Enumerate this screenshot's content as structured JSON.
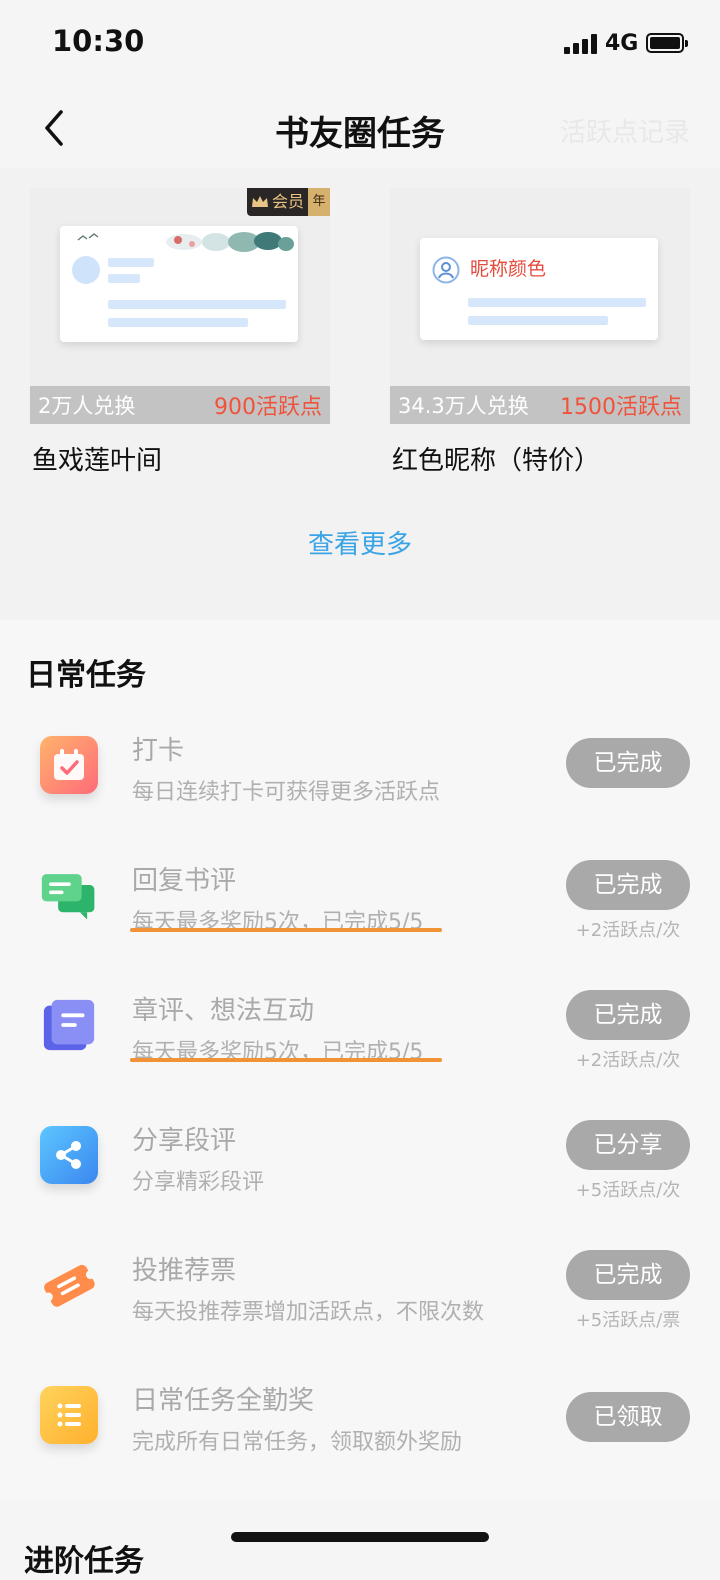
{
  "status_bar": {
    "time": "10:30",
    "network": "4G"
  },
  "nav": {
    "title": "书友圈任务",
    "right_link": "活跃点记录"
  },
  "rewards": [
    {
      "badge": "会员",
      "badge_tag": "年",
      "count": "2万人兑换",
      "points": "900活跃点",
      "name": "鱼戏莲叶间"
    },
    {
      "preview_text": "昵称颜色",
      "count": "34.3万人兑换",
      "points": "1500活跃点",
      "name": "红色昵称（特价）"
    }
  ],
  "see_more": "查看更多",
  "daily": {
    "section_title": "日常任务",
    "tasks": [
      {
        "icon": "calendar-check-icon",
        "title": "打卡",
        "sub": "每日连续打卡可获得更多活跃点",
        "button": "已完成",
        "reward": ""
      },
      {
        "icon": "chat-bubbles-icon",
        "title": "回复书评",
        "sub": "每天最多奖励5次，已完成5/5",
        "button": "已完成",
        "reward": "+2活跃点/次"
      },
      {
        "icon": "document-icon",
        "title": "章评、想法互动",
        "sub": "每天最多奖励5次，已完成5/5",
        "button": "已完成",
        "reward": "+2活跃点/次"
      },
      {
        "icon": "share-icon",
        "title": "分享段评",
        "sub": "分享精彩段评",
        "button": "已分享",
        "reward": "+5活跃点/次"
      },
      {
        "icon": "ticket-icon",
        "title": "投推荐票",
        "sub": "每天投推荐票增加活跃点，不限次数",
        "button": "已完成",
        "reward": "+5活跃点/票"
      },
      {
        "icon": "list-icon",
        "title": "日常任务全勤奖",
        "sub": "完成所有日常任务，领取额外奖励",
        "button": "已领取",
        "reward": ""
      }
    ]
  },
  "next_section_title": "进阶任务"
}
